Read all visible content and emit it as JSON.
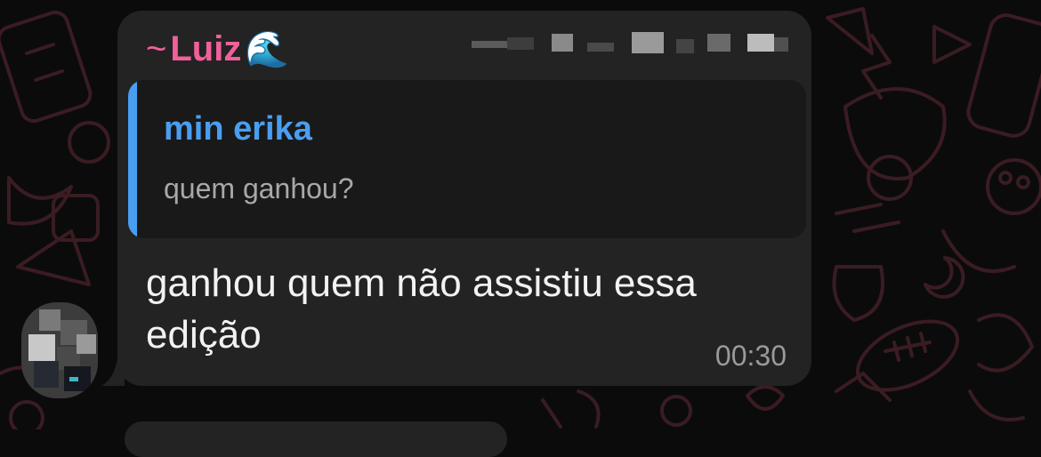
{
  "message": {
    "sender_name": "Luiz",
    "sender_prefix": "~",
    "sender_emoji": "🌊",
    "reply": {
      "author": "min erika",
      "text": "quem ganhou?"
    },
    "text": "ganhou quem não assistiu essa edição",
    "time": "00:30"
  },
  "colors": {
    "background": "#0b0b0b",
    "bubble": "#232323",
    "quote_background": "#191919",
    "sender_name": "#f0609a",
    "reply_accent": "#4a9ef0",
    "message_text": "#f2f2f2",
    "timestamp": "#9a9a9a",
    "wallpaper_doodles": "#3a1c22"
  },
  "icons": {
    "sender_emoji": "water-wave-emoji",
    "wallpaper": "chat-doodle-wallpaper"
  }
}
